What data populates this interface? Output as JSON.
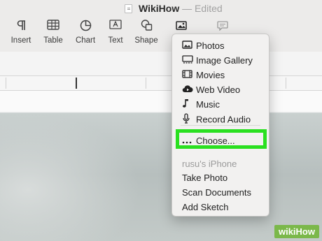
{
  "window": {
    "title": "WikiHow",
    "separator": "—",
    "status": "Edited"
  },
  "toolbar": {
    "items": [
      {
        "label": "Insert",
        "icon": "paragraph-icon"
      },
      {
        "label": "Table",
        "icon": "table-icon"
      },
      {
        "label": "Chart",
        "icon": "chart-icon"
      },
      {
        "label": "Text",
        "icon": "text-box-icon"
      },
      {
        "label": "Shape",
        "icon": "shape-icon"
      },
      {
        "label": "",
        "icon": "media-icon"
      },
      {
        "label": "",
        "icon": "comment-icon"
      }
    ]
  },
  "media_menu": {
    "items": [
      {
        "label": "Photos",
        "icon": "photos-icon"
      },
      {
        "label": "Image Gallery",
        "icon": "image-gallery-icon"
      },
      {
        "label": "Movies",
        "icon": "film-icon"
      },
      {
        "label": "Web Video",
        "icon": "cloud-play-icon"
      },
      {
        "label": "Music",
        "icon": "music-note-icon"
      },
      {
        "label": "Record Audio",
        "icon": "microphone-icon"
      }
    ],
    "choose": {
      "label": "Choose...",
      "icon": "ellipsis-icon"
    },
    "device_section": "rusu's iPhone",
    "device_items": [
      "Take Photo",
      "Scan Documents",
      "Add Sketch"
    ]
  },
  "watermark": {
    "prefix": "wiki",
    "suffix": "How"
  },
  "colors": {
    "highlight": "#2ae020",
    "watermark_bg": "#7bb84a"
  }
}
